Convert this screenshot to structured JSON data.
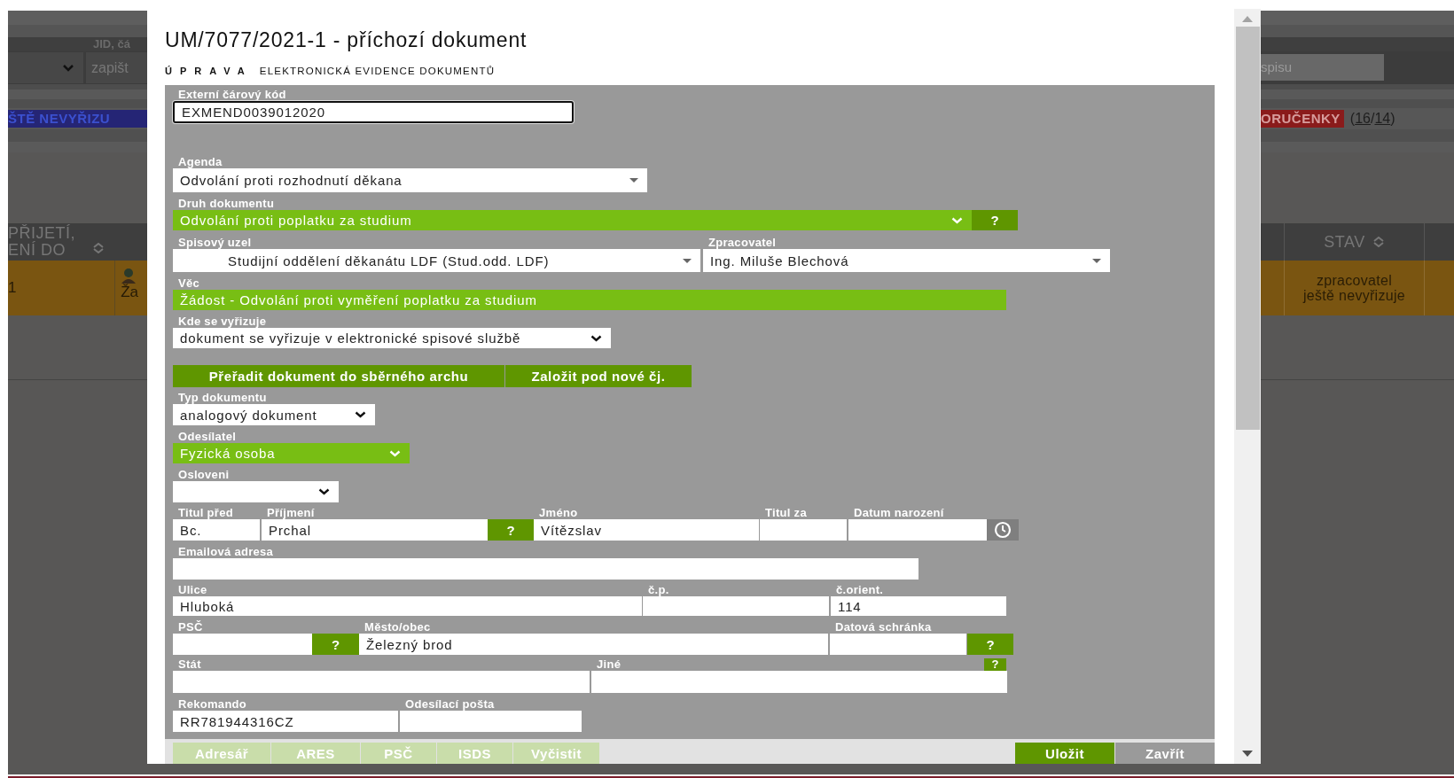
{
  "background": {
    "filter_label": "JID, čá",
    "filter_value": "zapišt",
    "search_value": "spisu",
    "status_tag": "ŠTĚ NEVYŘIZU",
    "receipt_tag": "ORUČENKY",
    "counts": {
      "open": "(",
      "first": "16",
      "separator": "/",
      "second": "14",
      "close": ")"
    },
    "columns": [
      {
        "lines": [
          "PŘIJETÍ,",
          "ENÍ DO"
        ],
        "sortable": true
      },
      {
        "lines": [
          "STAV"
        ],
        "sortable": true
      }
    ],
    "row": {
      "number": "1",
      "subject": "Ža",
      "status": "zpracovatel ještě nevyřizuje"
    }
  },
  "dialog": {
    "title": "UM/7077/2021-1 - příchozí dokument",
    "mode": "ÚPRAVA",
    "subtitle": "ELEKTRONICKÁ EVIDENCE DOKUMENTŮ",
    "rows": [
      {
        "fields": [
          {
            "kind": "text",
            "label": "Externí čárový kód",
            "value": "EXMEND0039012020",
            "highlighted": false,
            "focused": true
          }
        ]
      },
      {
        "fields": [
          {
            "kind": "combo",
            "label": "Agenda",
            "value": "Odvolání proti rozhodnutí děkana",
            "highlighted": false,
            "focused": false
          }
        ]
      },
      {
        "fields": [
          {
            "kind": "select",
            "label": "Druh dokumentu",
            "value": "Odvolání proti poplatku za studium",
            "highlighted": true,
            "focused": false
          },
          {
            "kind": "help",
            "text": "?"
          }
        ]
      },
      {
        "fields": [
          {
            "kind": "combo",
            "label": "Spisový uzel",
            "value": "Studijní oddělení děkanátu LDF (Stud.odd. LDF)",
            "highlighted": false,
            "focused": false
          },
          {
            "kind": "combo",
            "label": "Zpracovatel",
            "value": "Ing. Miluše Blechová",
            "highlighted": false,
            "focused": false
          }
        ]
      },
      {
        "fields": [
          {
            "kind": "text",
            "label": "Věc",
            "value": "Žádost - Odvolání proti vyměření poplatku za studium",
            "highlighted": true,
            "focused": false
          }
        ]
      },
      {
        "fields": [
          {
            "kind": "select",
            "label": "Kde se vyřizuje",
            "value": "dokument se vyřizuje v elektronické spisové službě",
            "highlighted": false,
            "focused": false
          }
        ]
      },
      {
        "fields": [
          {
            "kind": "button",
            "text": "Přeřadit dokument do sběrného archu"
          },
          {
            "kind": "button",
            "text": "Založit pod nové čj."
          }
        ]
      },
      {
        "fields": [
          {
            "kind": "select",
            "label": "Typ dokumentu",
            "value": "analogový dokument",
            "highlighted": false,
            "focused": false
          }
        ]
      },
      {
        "fields": [
          {
            "kind": "select",
            "label": "Odesílatel",
            "value": "Fyzická osoba",
            "highlighted": true,
            "focused": false
          }
        ]
      },
      {
        "fields": [
          {
            "kind": "select",
            "label": "Osloveni",
            "highlighted": false,
            "focused": false
          }
        ]
      },
      {
        "fields": [
          {
            "kind": "text",
            "label": "Titul před",
            "value": "Bc.",
            "highlighted": false,
            "focused": false
          },
          {
            "kind": "text",
            "label": "Příjmení",
            "value": "Prchal",
            "highlighted": false,
            "focused": false
          },
          {
            "kind": "help",
            "text": "?"
          },
          {
            "kind": "text",
            "label": "Jméno",
            "value": "Vítězslav",
            "highlighted": false,
            "focused": false
          },
          {
            "kind": "text",
            "label": "Titul za",
            "highlighted": false,
            "focused": false
          },
          {
            "kind": "text",
            "label": "Datum narození",
            "highlighted": false,
            "focused": false
          },
          {
            "kind": "clock"
          }
        ]
      },
      {
        "fields": [
          {
            "kind": "text",
            "label": "Emailová adresa",
            "highlighted": false,
            "focused": false
          }
        ]
      },
      {
        "fields": [
          {
            "kind": "text",
            "label": "Ulice",
            "value": "Hluboká",
            "highlighted": false,
            "focused": false
          },
          {
            "kind": "text",
            "label": "č.p.",
            "highlighted": false,
            "focused": false
          },
          {
            "kind": "text",
            "label": "č.orient.",
            "value": "114",
            "highlighted": false,
            "focused": false
          }
        ]
      },
      {
        "fields": [
          {
            "kind": "text",
            "label": "PSČ",
            "highlighted": false,
            "focused": false
          },
          {
            "kind": "help",
            "text": "?"
          },
          {
            "kind": "text",
            "label": "Město/obec",
            "value": "Železný brod",
            "highlighted": false,
            "focused": false
          },
          {
            "kind": "text",
            "label": "Datová schránka",
            "highlighted": false,
            "focused": false
          },
          {
            "kind": "help",
            "text": "?"
          }
        ]
      },
      {
        "fields": [
          {
            "kind": "text",
            "label": "Stát",
            "highlighted": false,
            "focused": false
          },
          {
            "kind": "text",
            "label": "Jiné",
            "help": "?",
            "highlighted": false,
            "focused": false
          }
        ]
      },
      {
        "fields": [
          {
            "kind": "text",
            "label": "Rekomando",
            "value": "RR781944316CZ",
            "highlighted": false,
            "focused": false
          },
          {
            "kind": "text",
            "label": "Odesílací pošta",
            "highlighted": false,
            "focused": false
          }
        ]
      }
    ],
    "lookup_buttons": [
      "Adresář",
      "ARES",
      "PSČ",
      "ISDS",
      "Vyčistit"
    ],
    "actions": [
      {
        "label": "Uložit",
        "primary": true
      },
      {
        "label": "Zavřít",
        "primary": false
      }
    ]
  }
}
